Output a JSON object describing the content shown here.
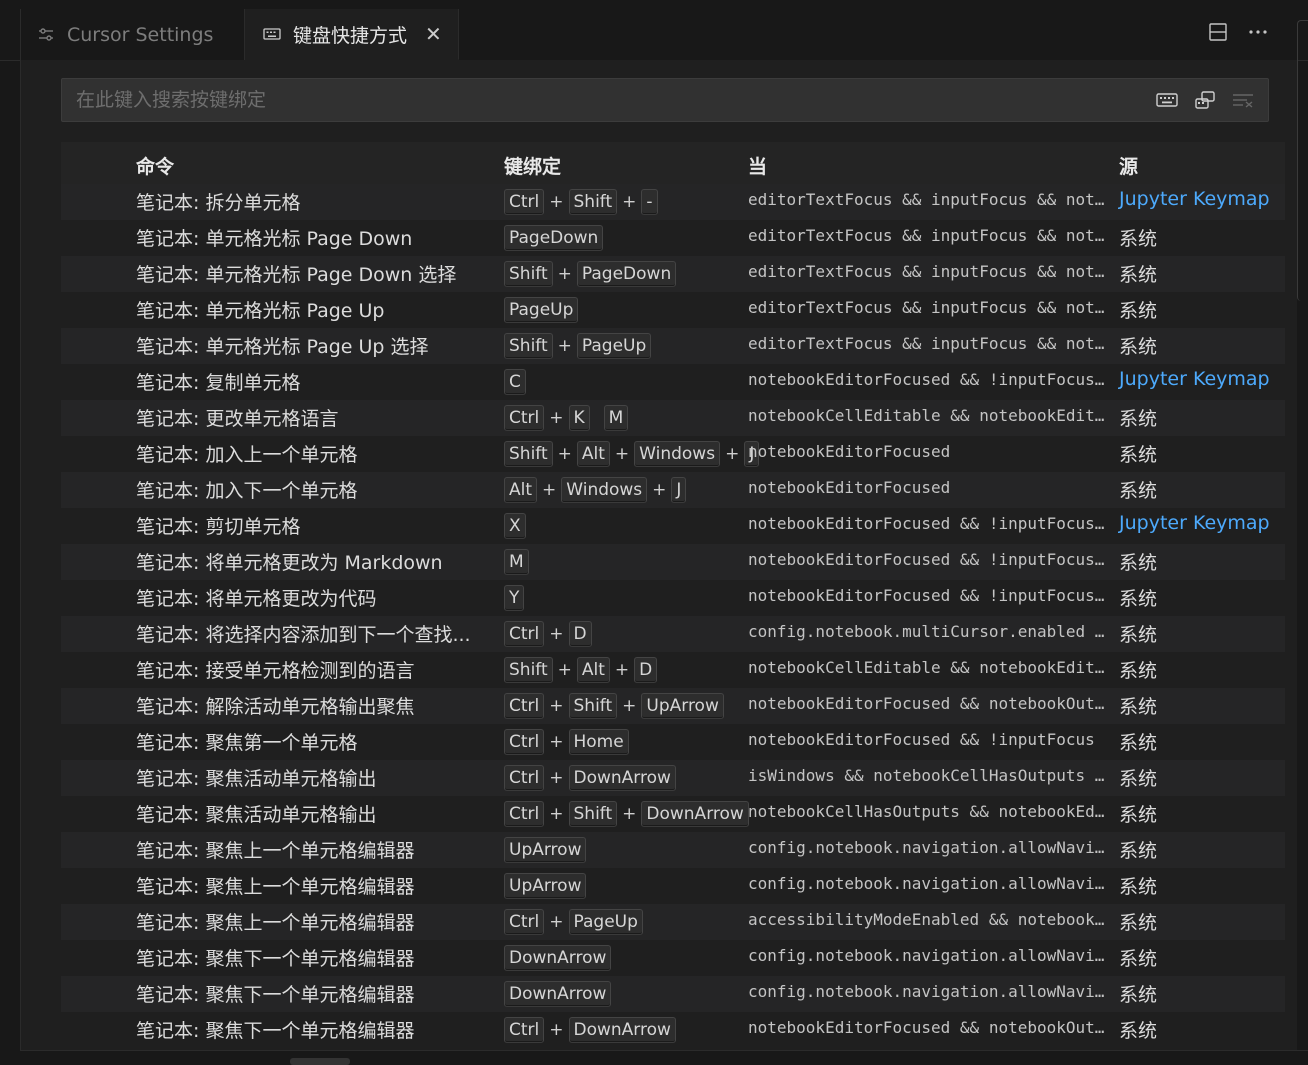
{
  "tabs": [
    {
      "label": "Cursor Settings",
      "active": false,
      "icon": "settings-sliders-icon"
    },
    {
      "label": "键盘快捷方式",
      "active": true,
      "icon": "keyboard-icon",
      "close": "✕"
    }
  ],
  "tab_actions": [
    "split-editor-icon",
    "more-actions-icon"
  ],
  "search": {
    "placeholder": "在此键入搜索按键绑定",
    "actions": [
      "record-keys-icon",
      "sort-by-precedence-icon",
      "clear-filter-icon"
    ]
  },
  "columns": {
    "command": "命令",
    "keybinding": "键绑定",
    "when": "当",
    "source": "源"
  },
  "rows": [
    {
      "command": "笔记本: 拆分单元格",
      "keys": [
        [
          "Ctrl",
          "Shift",
          "-"
        ]
      ],
      "when": "editorTextFocus && inputFocus && not…",
      "source": "Jupyter Keymap",
      "link": true
    },
    {
      "command": "笔记本: 单元格光标 Page Down",
      "keys": [
        [
          "PageDown"
        ]
      ],
      "when": "editorTextFocus && inputFocus && not…",
      "source": "系统",
      "link": false
    },
    {
      "command": "笔记本: 单元格光标 Page Down 选择",
      "keys": [
        [
          "Shift",
          "PageDown"
        ]
      ],
      "when": "editorTextFocus && inputFocus && not…",
      "source": "系统",
      "link": false
    },
    {
      "command": "笔记本: 单元格光标 Page Up",
      "keys": [
        [
          "PageUp"
        ]
      ],
      "when": "editorTextFocus && inputFocus && not…",
      "source": "系统",
      "link": false
    },
    {
      "command": "笔记本: 单元格光标 Page Up 选择",
      "keys": [
        [
          "Shift",
          "PageUp"
        ]
      ],
      "when": "editorTextFocus && inputFocus && not…",
      "source": "系统",
      "link": false
    },
    {
      "command": "笔记本: 复制单元格",
      "keys": [
        [
          "C"
        ]
      ],
      "when": "notebookEditorFocused && !inputFocus…",
      "source": "Jupyter Keymap",
      "link": true
    },
    {
      "command": "笔记本: 更改单元格语言",
      "keys": [
        [
          "Ctrl",
          "K"
        ],
        [
          "M"
        ]
      ],
      "when": "notebookCellEditable && notebookEdit…",
      "source": "系统",
      "link": false
    },
    {
      "command": "笔记本: 加入上一个单元格",
      "keys": [
        [
          "Shift",
          "Alt",
          "Windows",
          "J"
        ]
      ],
      "when": "notebookEditorFocused",
      "source": "系统",
      "link": false
    },
    {
      "command": "笔记本: 加入下一个单元格",
      "keys": [
        [
          "Alt",
          "Windows",
          "J"
        ]
      ],
      "when": "notebookEditorFocused",
      "source": "系统",
      "link": false
    },
    {
      "command": "笔记本: 剪切单元格",
      "keys": [
        [
          "X"
        ]
      ],
      "when": "notebookEditorFocused && !inputFocus…",
      "source": "Jupyter Keymap",
      "link": true
    },
    {
      "command": "笔记本: 将单元格更改为 Markdown",
      "keys": [
        [
          "M"
        ]
      ],
      "when": "notebookEditorFocused && !inputFocus…",
      "source": "系统",
      "link": false
    },
    {
      "command": "笔记本: 将单元格更改为代码",
      "keys": [
        [
          "Y"
        ]
      ],
      "when": "notebookEditorFocused && !inputFocus…",
      "source": "系统",
      "link": false
    },
    {
      "command": "笔记本: 将选择内容添加到下一个查找...",
      "keys": [
        [
          "Ctrl",
          "D"
        ]
      ],
      "when": "config.notebook.multiCursor.enabled …",
      "source": "系统",
      "link": false
    },
    {
      "command": "笔记本: 接受单元格检测到的语言",
      "keys": [
        [
          "Shift",
          "Alt",
          "D"
        ]
      ],
      "when": "notebookCellEditable && notebookEdit…",
      "source": "系统",
      "link": false
    },
    {
      "command": "笔记本: 解除活动单元格输出聚焦",
      "keys": [
        [
          "Ctrl",
          "Shift",
          "UpArrow"
        ]
      ],
      "when": "notebookEditorFocused && notebookOut…",
      "source": "系统",
      "link": false
    },
    {
      "command": "笔记本: 聚焦第一个单元格",
      "keys": [
        [
          "Ctrl",
          "Home"
        ]
      ],
      "when": "notebookEditorFocused && !inputFocus",
      "source": "系统",
      "link": false
    },
    {
      "command": "笔记本: 聚焦活动单元格输出",
      "keys": [
        [
          "Ctrl",
          "DownArrow"
        ]
      ],
      "when": "isWindows && notebookCellHasOutputs …",
      "source": "系统",
      "link": false
    },
    {
      "command": "笔记本: 聚焦活动单元格输出",
      "keys": [
        [
          "Ctrl",
          "Shift",
          "DownArrow"
        ]
      ],
      "when": "notebookCellHasOutputs && notebookEd…",
      "source": "系统",
      "link": false
    },
    {
      "command": "笔记本: 聚焦上一个单元格编辑器",
      "keys": [
        [
          "UpArrow"
        ]
      ],
      "when": "config.notebook.navigation.allowNavi…",
      "source": "系统",
      "link": false
    },
    {
      "command": "笔记本: 聚焦上一个单元格编辑器",
      "keys": [
        [
          "UpArrow"
        ]
      ],
      "when": "config.notebook.navigation.allowNavi…",
      "source": "系统",
      "link": false
    },
    {
      "command": "笔记本: 聚焦上一个单元格编辑器",
      "keys": [
        [
          "Ctrl",
          "PageUp"
        ]
      ],
      "when": "accessibilityModeEnabled && notebook…",
      "source": "系统",
      "link": false
    },
    {
      "command": "笔记本: 聚焦下一个单元格编辑器",
      "keys": [
        [
          "DownArrow"
        ]
      ],
      "when": "config.notebook.navigation.allowNavi…",
      "source": "系统",
      "link": false
    },
    {
      "command": "笔记本: 聚焦下一个单元格编辑器",
      "keys": [
        [
          "DownArrow"
        ]
      ],
      "when": "config.notebook.navigation.allowNavi…",
      "source": "系统",
      "link": false
    },
    {
      "command": "笔记本: 聚焦下一个单元格编辑器",
      "keys": [
        [
          "Ctrl",
          "DownArrow"
        ]
      ],
      "when": "notebookEditorFocused && notebookOut…",
      "source": "系统",
      "link": false
    }
  ],
  "colors": {
    "accent_link": "#4daafc",
    "background": "#1f1f1f",
    "row_alt": "#252526"
  }
}
